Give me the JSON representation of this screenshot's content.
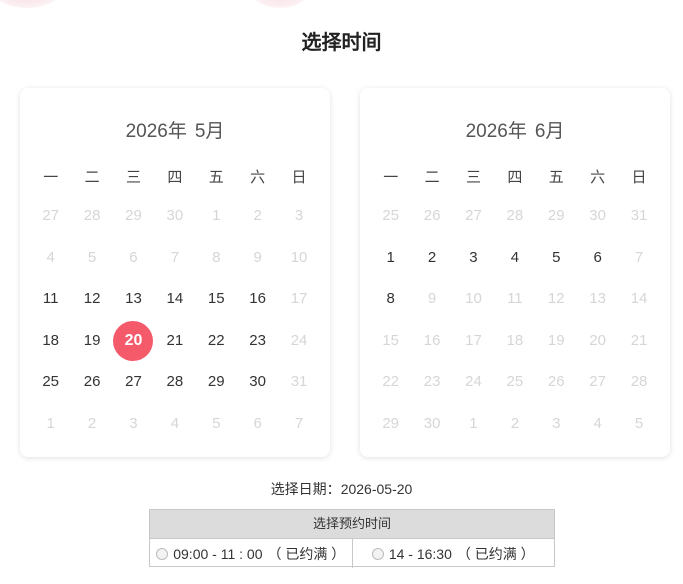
{
  "page": {
    "title": "选择时间"
  },
  "weekdays": [
    "一",
    "二",
    "三",
    "四",
    "五",
    "六",
    "日"
  ],
  "calendars": [
    {
      "year": "2026年",
      "month": "5月",
      "days": [
        {
          "d": "27",
          "dis": true
        },
        {
          "d": "28",
          "dis": true
        },
        {
          "d": "29",
          "dis": true
        },
        {
          "d": "30",
          "dis": true
        },
        {
          "d": "1",
          "dis": true
        },
        {
          "d": "2",
          "dis": true
        },
        {
          "d": "3",
          "dis": true
        },
        {
          "d": "4",
          "dis": true
        },
        {
          "d": "5",
          "dis": true
        },
        {
          "d": "6",
          "dis": true
        },
        {
          "d": "7",
          "dis": true
        },
        {
          "d": "8",
          "dis": true
        },
        {
          "d": "9",
          "dis": true
        },
        {
          "d": "10",
          "dis": true
        },
        {
          "d": "11"
        },
        {
          "d": "12"
        },
        {
          "d": "13"
        },
        {
          "d": "14"
        },
        {
          "d": "15"
        },
        {
          "d": "16"
        },
        {
          "d": "17",
          "dis": true
        },
        {
          "d": "18"
        },
        {
          "d": "19"
        },
        {
          "d": "20",
          "sel": true
        },
        {
          "d": "21"
        },
        {
          "d": "22"
        },
        {
          "d": "23"
        },
        {
          "d": "24",
          "dis": true
        },
        {
          "d": "25"
        },
        {
          "d": "26"
        },
        {
          "d": "27"
        },
        {
          "d": "28"
        },
        {
          "d": "29"
        },
        {
          "d": "30"
        },
        {
          "d": "31",
          "dis": true
        },
        {
          "d": "1",
          "dis": true
        },
        {
          "d": "2",
          "dis": true
        },
        {
          "d": "3",
          "dis": true
        },
        {
          "d": "4",
          "dis": true
        },
        {
          "d": "5",
          "dis": true
        },
        {
          "d": "6",
          "dis": true
        },
        {
          "d": "7",
          "dis": true
        }
      ]
    },
    {
      "year": "2026年",
      "month": "6月",
      "days": [
        {
          "d": "25",
          "dis": true
        },
        {
          "d": "26",
          "dis": true
        },
        {
          "d": "27",
          "dis": true
        },
        {
          "d": "28",
          "dis": true
        },
        {
          "d": "29",
          "dis": true
        },
        {
          "d": "30",
          "dis": true
        },
        {
          "d": "31",
          "dis": true
        },
        {
          "d": "1"
        },
        {
          "d": "2"
        },
        {
          "d": "3"
        },
        {
          "d": "4"
        },
        {
          "d": "5"
        },
        {
          "d": "6"
        },
        {
          "d": "7",
          "dis": true
        },
        {
          "d": "8"
        },
        {
          "d": "9",
          "dis": true
        },
        {
          "d": "10",
          "dis": true
        },
        {
          "d": "11",
          "dis": true
        },
        {
          "d": "12",
          "dis": true
        },
        {
          "d": "13",
          "dis": true
        },
        {
          "d": "14",
          "dis": true
        },
        {
          "d": "15",
          "dis": true
        },
        {
          "d": "16",
          "dis": true
        },
        {
          "d": "17",
          "dis": true
        },
        {
          "d": "18",
          "dis": true
        },
        {
          "d": "19",
          "dis": true
        },
        {
          "d": "20",
          "dis": true
        },
        {
          "d": "21",
          "dis": true
        },
        {
          "d": "22",
          "dis": true
        },
        {
          "d": "23",
          "dis": true
        },
        {
          "d": "24",
          "dis": true
        },
        {
          "d": "25",
          "dis": true
        },
        {
          "d": "26",
          "dis": true
        },
        {
          "d": "27",
          "dis": true
        },
        {
          "d": "28",
          "dis": true
        },
        {
          "d": "29",
          "dis": true
        },
        {
          "d": "30",
          "dis": true
        },
        {
          "d": "1",
          "dis": true
        },
        {
          "d": "2",
          "dis": true
        },
        {
          "d": "3",
          "dis": true
        },
        {
          "d": "4",
          "dis": true
        },
        {
          "d": "5",
          "dis": true
        }
      ]
    }
  ],
  "selected_date": {
    "label": "选择日期：",
    "value": "2026-05-20"
  },
  "time_slots": {
    "header": "选择预约时间",
    "slots": [
      {
        "time": "09:00 - 11 : 00",
        "status": "（ 已约满 ）"
      },
      {
        "time": "14 - 16:30",
        "status": "（ 已约满 ）"
      }
    ]
  },
  "colors": {
    "accent": "#f55a6a",
    "disabled_text": "#d6d6d6",
    "table_header_bg": "#dcdcdc"
  }
}
